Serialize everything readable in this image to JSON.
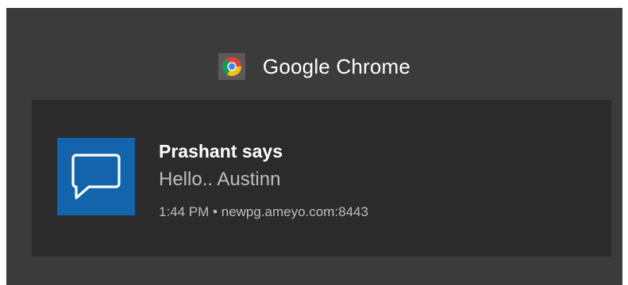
{
  "group": {
    "app_name": "Google Chrome",
    "icon": "chrome-icon"
  },
  "notification": {
    "icon": "chat-bubble-icon",
    "title": "Prashant says",
    "body": "Hello.. Austinn",
    "time": "1:44 PM",
    "separator": "•",
    "source": "newpg.ameyo.com:8443"
  },
  "colors": {
    "panel_background": "#3b3b3b",
    "toast_background": "#2b2b2b",
    "app_icon_background": "#1464ac",
    "primary_text": "#ffffff",
    "secondary_text": "#bdbdbd"
  }
}
